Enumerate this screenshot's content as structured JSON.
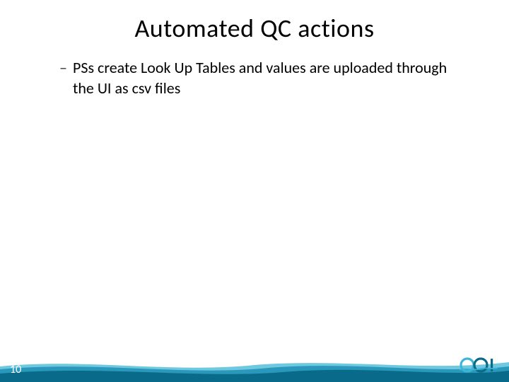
{
  "slide": {
    "title": "Automated QC actions",
    "bullet_dash": "–",
    "bullet_text": "PSs create Look Up Tables and values are uploaded through the UI as csv files",
    "page_number": "10"
  },
  "colors": {
    "wave_dark": "#0a6a8a",
    "wave_mid": "#1d8fb3",
    "wave_light": "#3eb5d6",
    "logo_primary": "#0a6a8a",
    "logo_accent": "#3eb5d6"
  }
}
